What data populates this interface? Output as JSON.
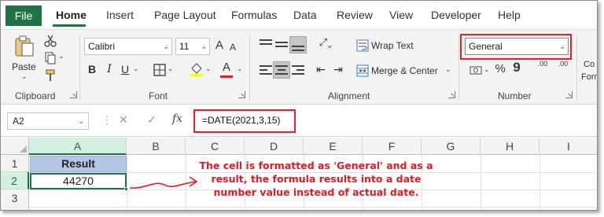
{
  "tabs": {
    "file": "File",
    "items": [
      "Home",
      "Insert",
      "Page Layout",
      "Formulas",
      "Data",
      "Review",
      "View",
      "Developer",
      "Help"
    ]
  },
  "clipboard": {
    "paste_label": "Paste",
    "group_label": "Clipboard"
  },
  "font": {
    "name": "Calibri",
    "size": "11",
    "grow": "A",
    "shrink": "A",
    "bold": "B",
    "italic": "I",
    "underline": "U",
    "color_a": "A",
    "group_label": "Font"
  },
  "alignment": {
    "wrap_text": "Wrap Text",
    "merge_center": "Merge & Center",
    "group_label": "Alignment"
  },
  "number": {
    "format": "General",
    "percent": "%",
    "comma": "9",
    "inc_decimal": ".00",
    "dec_decimal": ".00",
    "group_label": "Number"
  },
  "styles": {
    "cond_label_1": "Co",
    "cond_label_2": "Form"
  },
  "formula_bar": {
    "name_box": "A2",
    "cancel": "✕",
    "enter": "✓",
    "fx": "fx",
    "formula": "=DATE(2021,3,15)"
  },
  "grid": {
    "columns": [
      "A",
      "B",
      "C",
      "D",
      "E",
      "F",
      "G",
      "H",
      "I"
    ],
    "rows": [
      "1",
      "2",
      "3"
    ],
    "cells": {
      "A1": "Result",
      "A2": "44270"
    }
  },
  "annotation": "The cell is formatted as 'General' and as a result, the formula results into a date number value instead of actual date.",
  "colors": {
    "excel_green": "#217346",
    "header_fill": "#b4c6e7",
    "annotation_red": "#e01b24",
    "font_color_bar": "#e5202a"
  },
  "icons": [
    "paste-icon",
    "cut-icon",
    "copy-icon",
    "format-painter-icon",
    "border-icon",
    "fill-color-icon",
    "font-color-icon",
    "wrap-text-icon",
    "merge-center-icon",
    "accounting-format-icon",
    "percent-icon",
    "comma-icon",
    "increase-decimal-icon",
    "decrease-decimal-icon",
    "dialog-launcher-icon",
    "cancel-icon",
    "enter-icon",
    "fx-icon",
    "arrow-icon"
  ]
}
